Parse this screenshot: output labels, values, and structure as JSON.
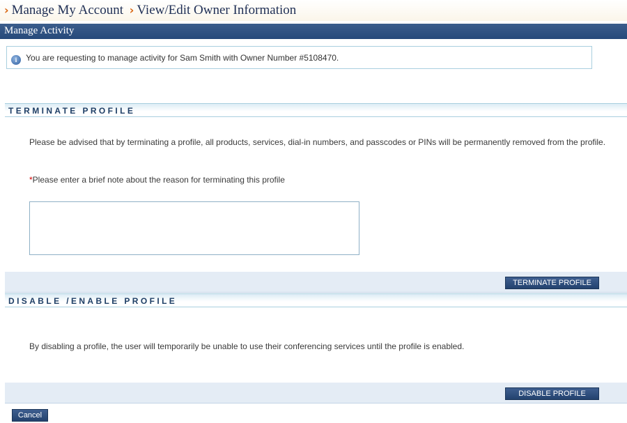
{
  "breadcrumb": {
    "separator": "›",
    "items": [
      "Manage My Account",
      "View/Edit Owner Information"
    ]
  },
  "manage_bar": {
    "title": "Manage Activity"
  },
  "info": {
    "icon": "info-icon",
    "text": "You are requesting to manage activity for Sam Smith with Owner Number #5108470."
  },
  "terminate": {
    "header": "TERMINATE PROFILE",
    "warning": "Please be advised that by terminating a profile, all products, services, dial-in numbers, and passcodes or PINs will be permanently removed from the profile.",
    "required_mark": "*",
    "reason_label": "Please enter a brief note about the reason for terminating this profile",
    "reason_value": "",
    "button_label": "TERMINATE PROFILE"
  },
  "disable": {
    "header": "DISABLE /ENABLE PROFILE",
    "description": "By disabling a profile, the user will temporarily be unable to use their conferencing services until the profile is enabled.",
    "button_label": "DISABLE PROFILE"
  },
  "cancel_label": "Cancel",
  "colors": {
    "nav_bar": "#26497a",
    "button": "#2f4f7f",
    "section_border": "#a9cfdf",
    "accent_arrow": "#d9650f",
    "required": "#d10000"
  }
}
